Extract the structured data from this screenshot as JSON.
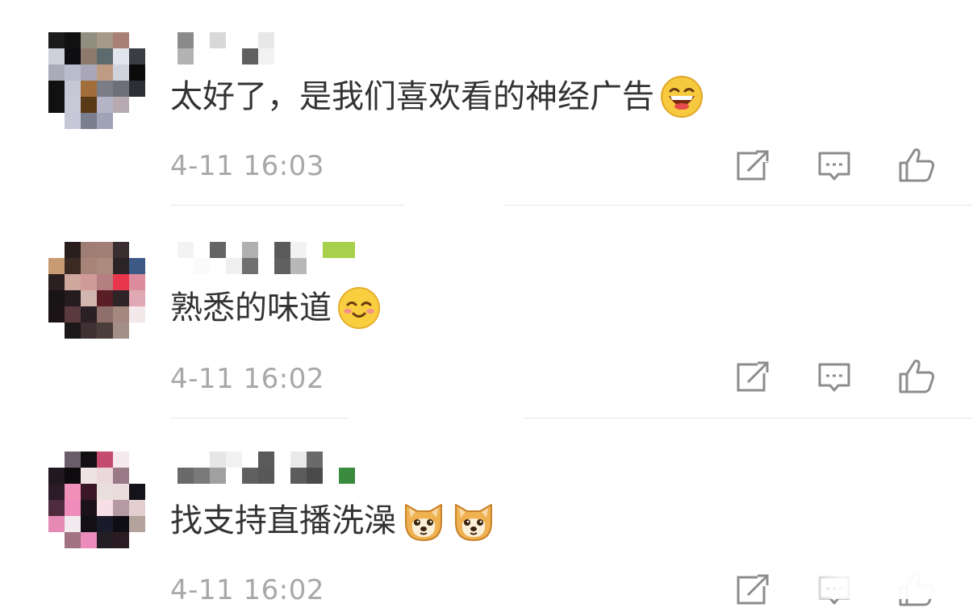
{
  "comments": [
    {
      "text": "太好了，是我们喜欢看的神经广告",
      "emoji": "grinning-laugh-emoji",
      "time": "4-11 16:03"
    },
    {
      "text": "熟悉的味道",
      "emoji": "smile-blush-emoji",
      "time": "4-11 16:02"
    },
    {
      "text": "找支持直播洗澡",
      "emoji": "doge-emoji",
      "time": "4-11 16:02"
    }
  ],
  "actions": {
    "icons": [
      "share-icon",
      "reply-comment-icon",
      "thumbs-up-icon"
    ]
  },
  "colors": {
    "text": "#333333",
    "meta": "#a8a8a8",
    "icon": "#8c8c8c",
    "divider": "#e6e6e6"
  }
}
